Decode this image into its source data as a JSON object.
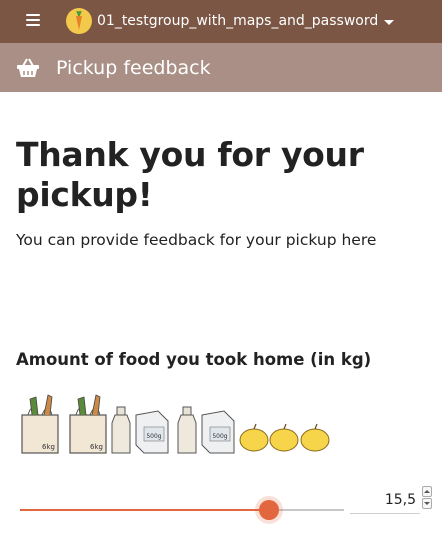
{
  "topbar": {
    "group_name": "01_testgroup_with_maps_and_password",
    "background_color": "#7b5645"
  },
  "subbar": {
    "title": "Pickup feedback",
    "background_color": "#a98f86"
  },
  "main": {
    "headline": "Thank you for your pickup!",
    "subtext": "You can provide feedback for your pickup here",
    "amount_label": "Amount of food you took home (in kg)",
    "food_icons": [
      "bag-icon",
      "bag-icon",
      "bottle-icon",
      "flour-pack-icon",
      "bottle-icon",
      "flour-pack-icon",
      "apple-icon",
      "apple-icon",
      "apple-icon"
    ],
    "bag_label": "6kg",
    "pack_label": "500g"
  },
  "slider": {
    "value_text": "15,5",
    "fill_fraction": 0.77,
    "accent_color": "#e2663e"
  }
}
